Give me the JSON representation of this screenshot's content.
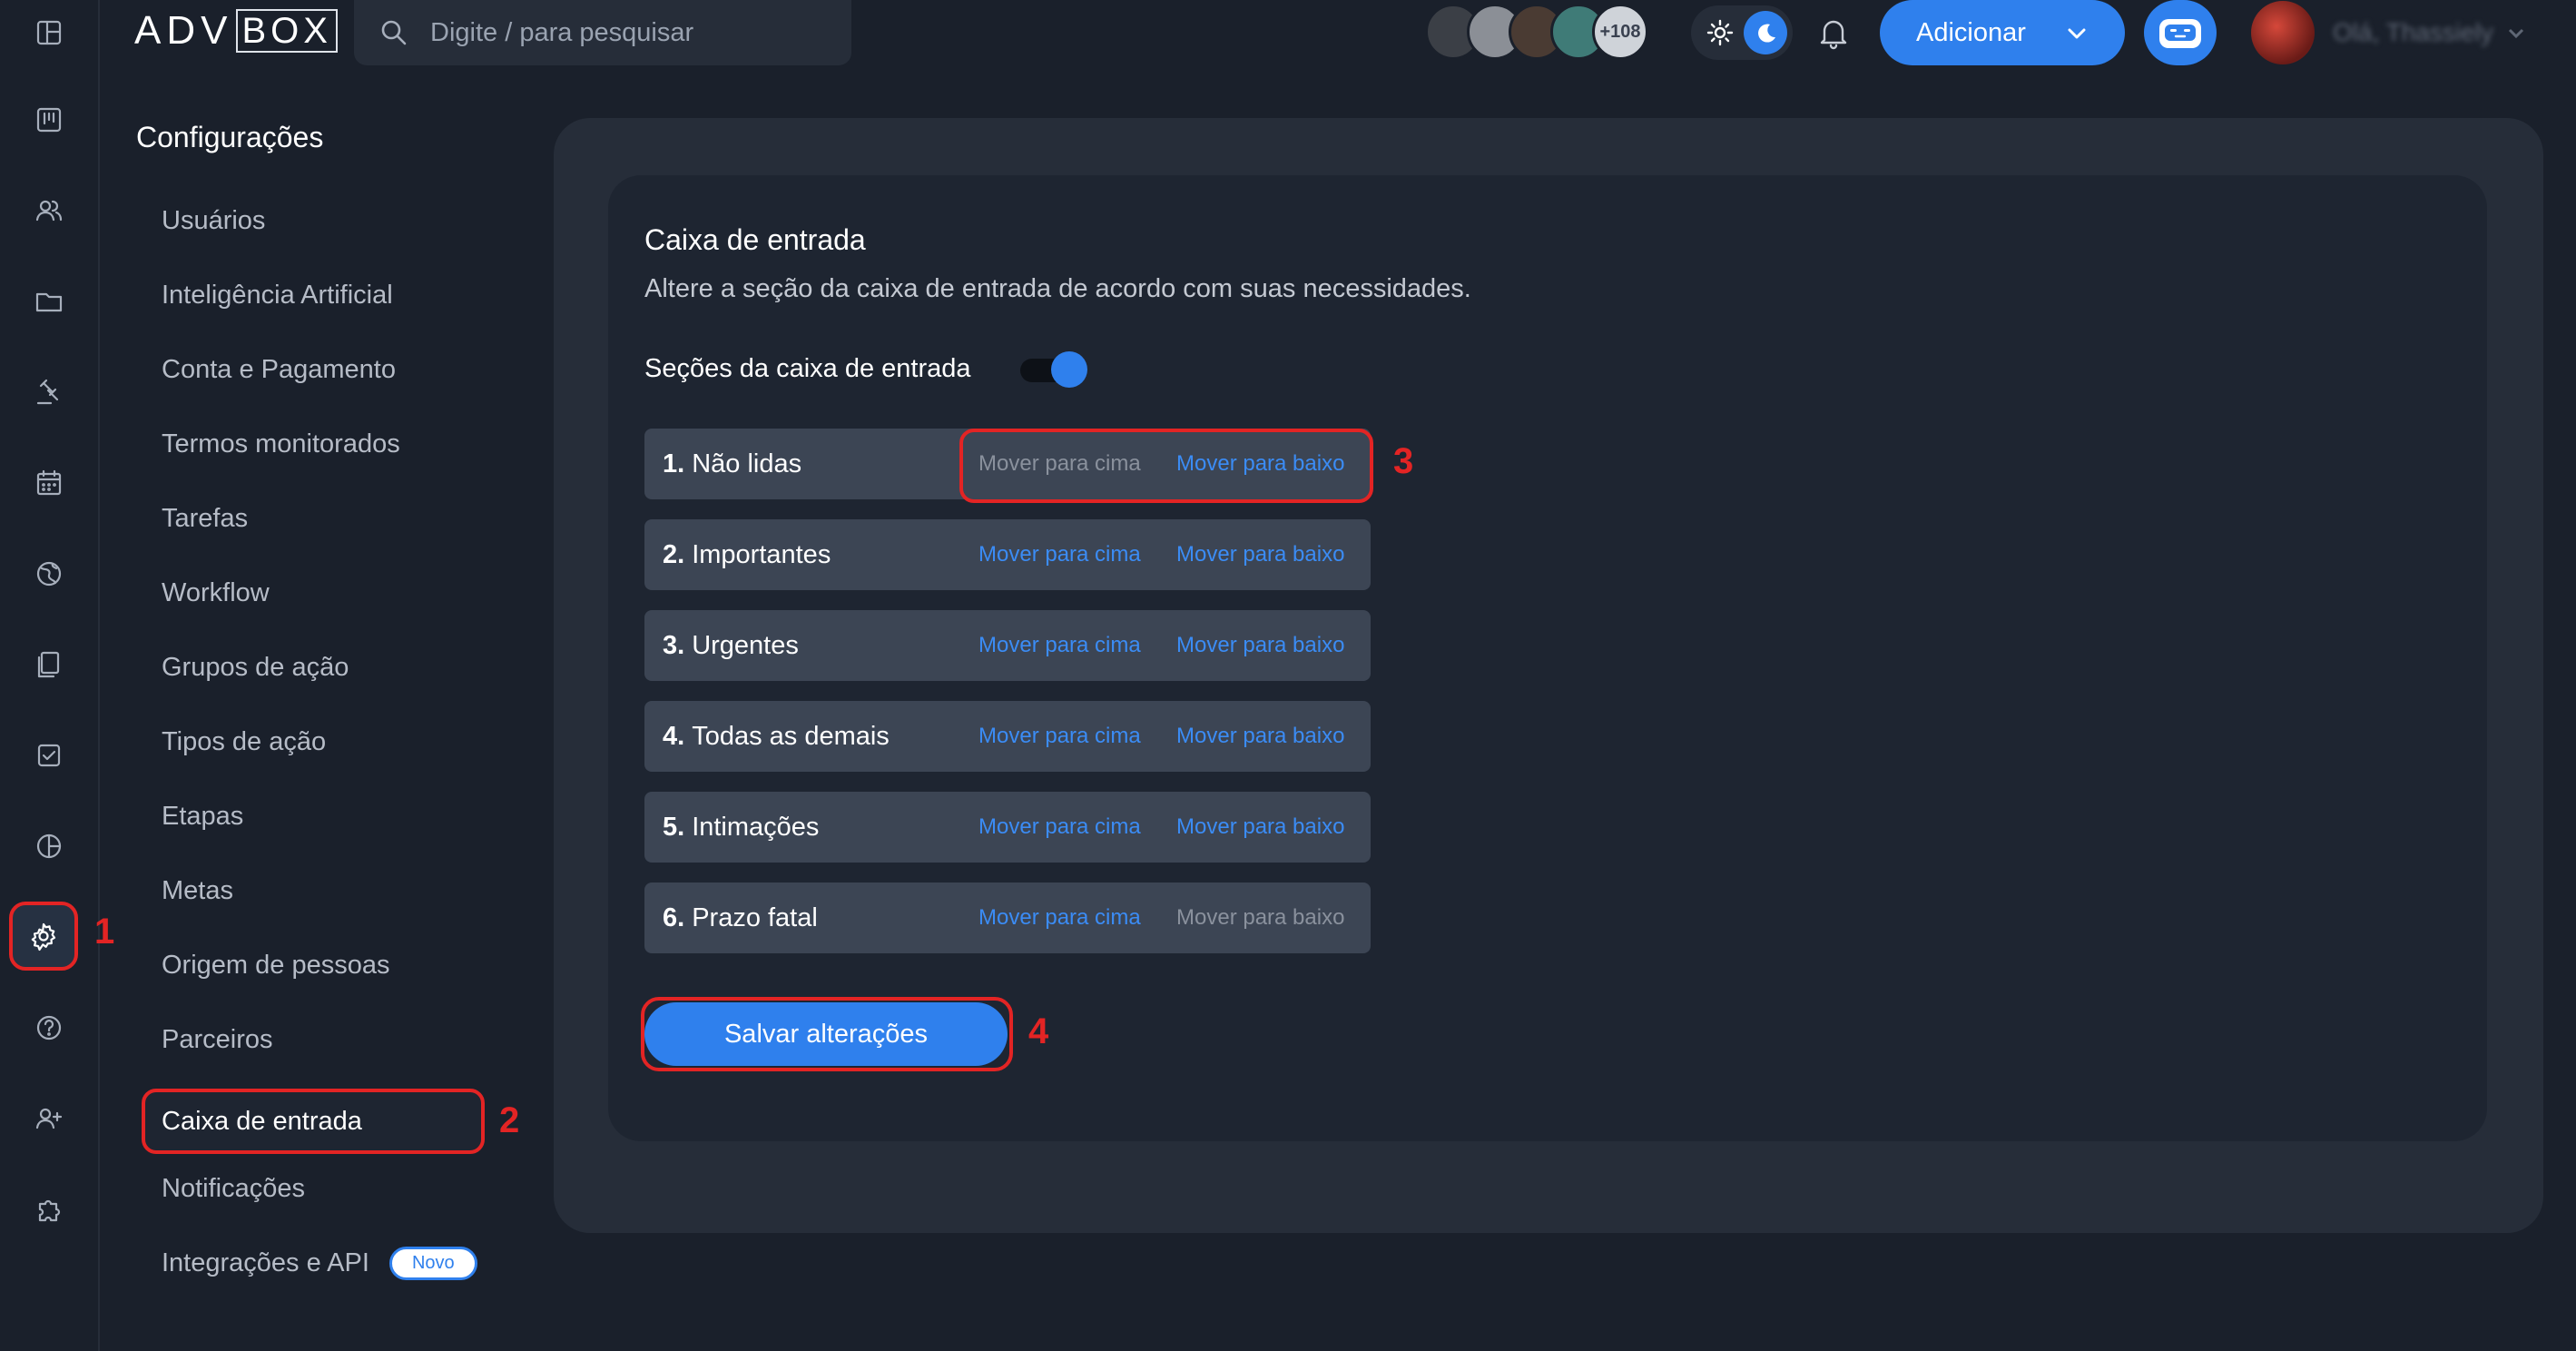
{
  "header": {
    "logo_adv": "ADV",
    "logo_box": "BOX",
    "search_placeholder": "Digite / para pesquisar",
    "avatar_count": "+108",
    "add_button": "Adicionar",
    "user_name": "Olá, Thassiely"
  },
  "settings": {
    "title": "Configurações",
    "menu": [
      {
        "label": "Usuários"
      },
      {
        "label": "Inteligência Artificial"
      },
      {
        "label": "Conta e Pagamento"
      },
      {
        "label": "Termos monitorados"
      },
      {
        "label": "Tarefas"
      },
      {
        "label": "Workflow"
      },
      {
        "label": "Grupos de ação"
      },
      {
        "label": "Tipos de ação"
      },
      {
        "label": "Etapas"
      },
      {
        "label": "Metas"
      },
      {
        "label": "Origem de pessoas"
      },
      {
        "label": "Parceiros"
      },
      {
        "label": "Caixa de entrada",
        "active": true
      },
      {
        "label": "Notificações"
      },
      {
        "label": "Integrações e API",
        "badge": "Novo"
      }
    ]
  },
  "inbox": {
    "title": "Caixa de entrada",
    "description": "Altere a seção da caixa de entrada de acordo com suas necessidades.",
    "toggle_label": "Seções da caixa de entrada",
    "toggle_on": true,
    "move_up_label": "Mover para cima",
    "move_down_label": "Mover para baixo",
    "sections": [
      {
        "number": "1.",
        "name": "Não lidas",
        "up_enabled": false,
        "down_enabled": true
      },
      {
        "number": "2.",
        "name": "Importantes",
        "up_enabled": true,
        "down_enabled": true
      },
      {
        "number": "3.",
        "name": "Urgentes",
        "up_enabled": true,
        "down_enabled": true
      },
      {
        "number": "4.",
        "name": "Todas as demais",
        "up_enabled": true,
        "down_enabled": true
      },
      {
        "number": "5.",
        "name": "Intimações",
        "up_enabled": true,
        "down_enabled": true
      },
      {
        "number": "6.",
        "name": "Prazo fatal",
        "up_enabled": true,
        "down_enabled": false
      }
    ],
    "save_button": "Salvar alterações"
  },
  "annotations": [
    "1",
    "2",
    "3",
    "4"
  ],
  "colors": {
    "background": "#1a202b",
    "accent": "#2f80ed",
    "highlight": "#e32424",
    "row": "#3c4554"
  }
}
